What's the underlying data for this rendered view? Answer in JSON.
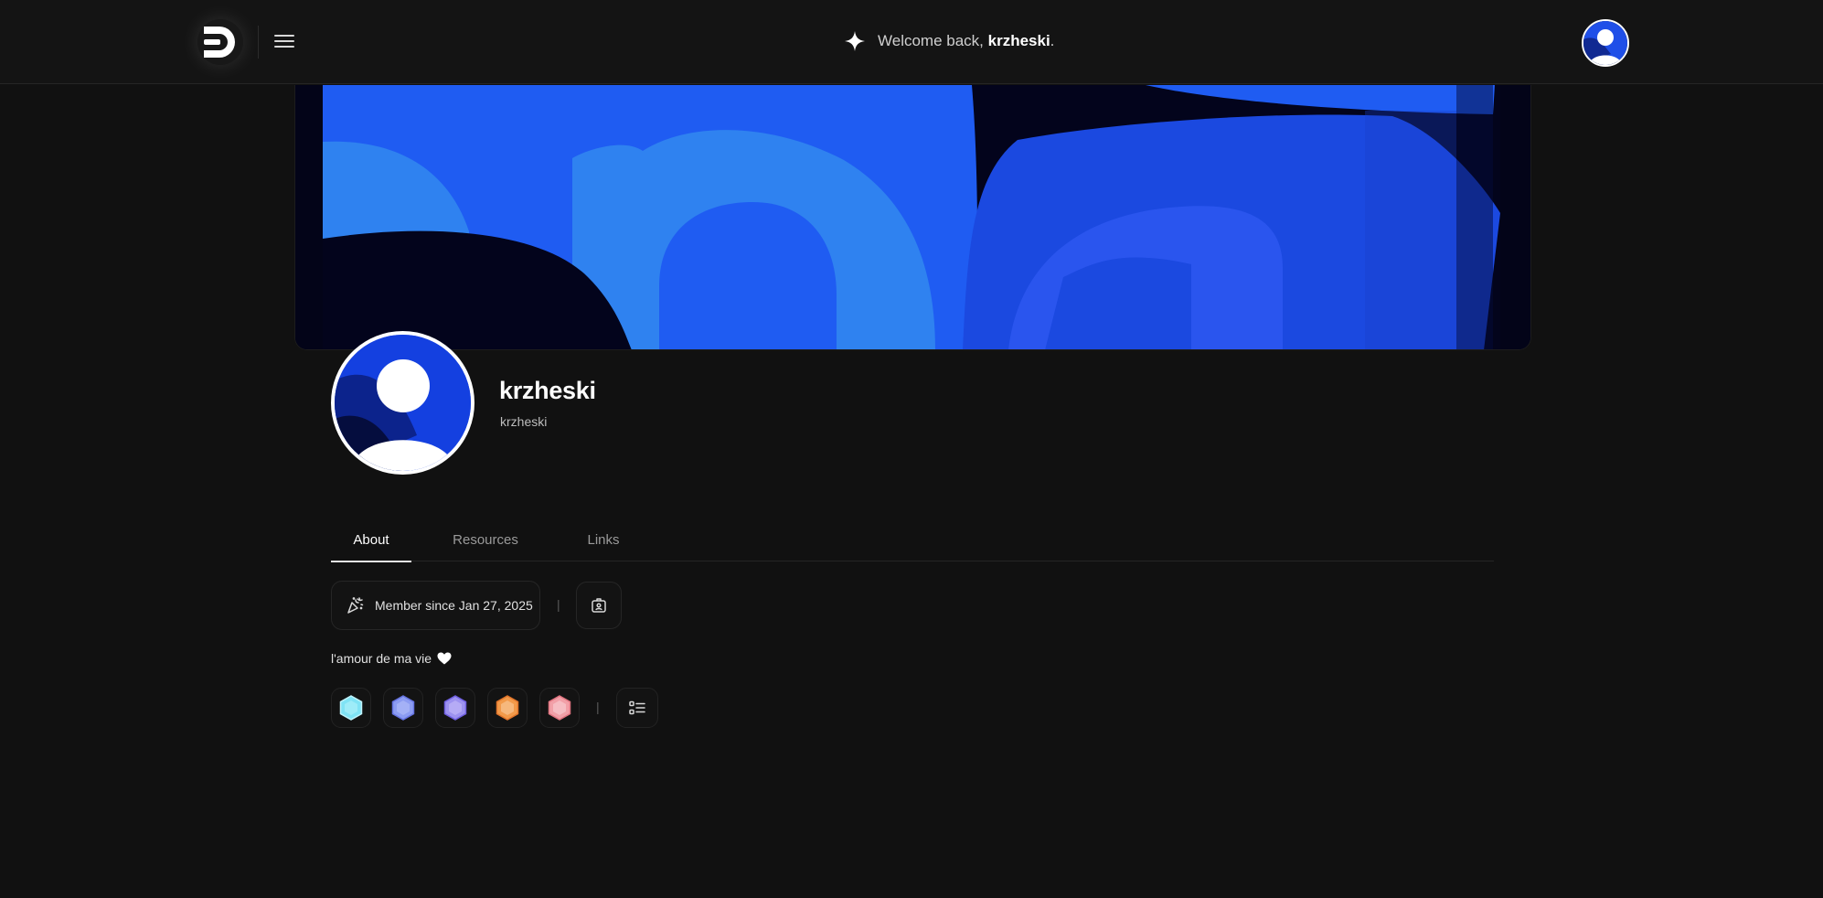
{
  "header": {
    "welcome_prefix": "Welcome back, ",
    "welcome_user": "krzheski",
    "welcome_suffix": "."
  },
  "profile": {
    "display_name": "krzheski",
    "username": "krzheski",
    "bio": "l'amour de ma vie"
  },
  "tabs": [
    {
      "label": "About",
      "active": true
    },
    {
      "label": "Resources",
      "active": false
    },
    {
      "label": "Links",
      "active": false
    }
  ],
  "about": {
    "member_since": "Member since Jan 27, 2025",
    "separator": "|"
  },
  "badges": [
    {
      "icon": "hexagon-cyan-badge-icon",
      "color": "#7fe3f5"
    },
    {
      "icon": "hexagon-blue-badge-icon",
      "color": "#8c9cf2"
    },
    {
      "icon": "hexagon-violet-badge-icon",
      "color": "#9d92f0"
    },
    {
      "icon": "hexagon-orange-badge-icon",
      "color": "#f29a4a"
    },
    {
      "icon": "hexagon-pink-badge-icon",
      "color": "#f2a0a8"
    }
  ],
  "colors": {
    "background": "#111111",
    "banner_blue": "#1f5cf2",
    "banner_light_blue": "#2f82f0"
  }
}
